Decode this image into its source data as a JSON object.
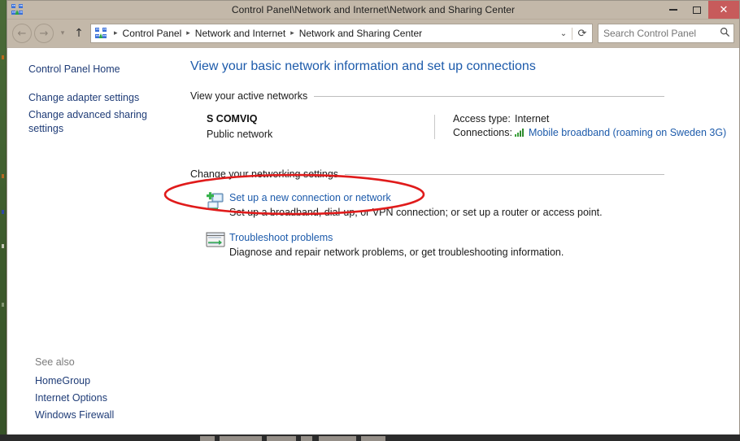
{
  "window": {
    "title": "Control Panel\\Network and Internet\\Network and Sharing Center",
    "title_icon": "network-sharing-icon",
    "controls": {
      "minimize": "–",
      "maximize": "□",
      "close": "✕"
    },
    "accent_close_color": "#c75b5b",
    "chrome_color": "#c3b8a9"
  },
  "nav": {
    "back": "←",
    "forward": "→",
    "recent_dropdown": "▾",
    "up": "↑",
    "address_icon": "network-sharing-icon",
    "breadcrumbs": [
      "Control Panel",
      "Network and Internet",
      "Network and Sharing Center"
    ],
    "separator": "▸",
    "address_dropdown": "⌄",
    "refresh": "⟳",
    "search": {
      "placeholder": "Search Control Panel",
      "value": "",
      "icon": "search-icon"
    }
  },
  "sidebar": {
    "items": [
      {
        "label": "Control Panel Home"
      },
      {
        "label": "Change adapter settings"
      },
      {
        "label": "Change advanced sharing settings"
      }
    ],
    "see_also": {
      "title": "See also",
      "items": [
        {
          "label": "HomeGroup"
        },
        {
          "label": "Internet Options"
        },
        {
          "label": "Windows Firewall"
        }
      ]
    }
  },
  "main": {
    "heading": "View your basic network information and set up connections",
    "active_networks": {
      "section_title": "View your active networks",
      "network": {
        "name": "S COMVIQ",
        "type": "Public network",
        "access_type_label": "Access type:",
        "access_type_value": "Internet",
        "connections_label": "Connections:",
        "connection_icon": "signal-bars-icon",
        "connection_value": "Mobile broadband (roaming on Sweden 3G)"
      }
    },
    "networking_settings": {
      "section_title": "Change your networking settings",
      "tasks": [
        {
          "icon": "new-connection-icon",
          "title": "Set up a new connection or network",
          "description": "Set up a broadband, dial-up, or VPN connection; or set up a router or access point."
        },
        {
          "icon": "troubleshoot-icon",
          "title": "Troubleshoot problems",
          "description": "Diagnose and repair network problems, or get troubleshooting information."
        }
      ]
    }
  },
  "annotation": {
    "shape": "ellipse",
    "color": "#e01b1b",
    "target": "Set up a new connection or network"
  }
}
